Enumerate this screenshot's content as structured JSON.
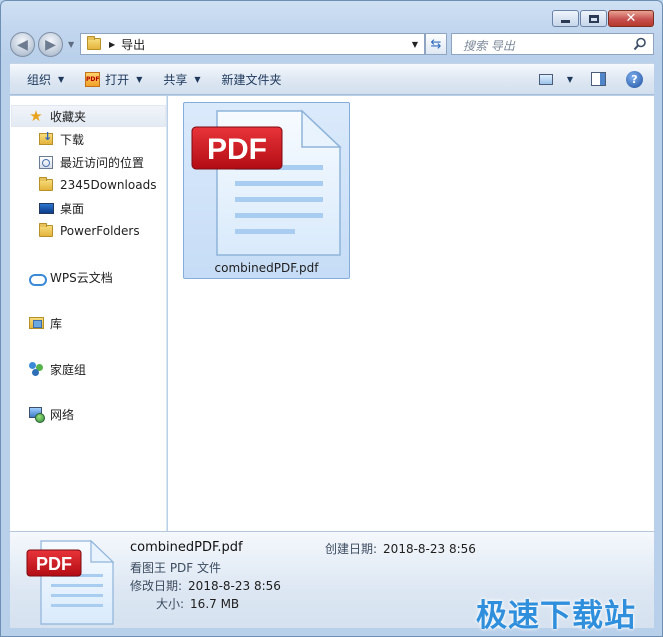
{
  "window": {
    "title": "导出"
  },
  "nav": {
    "breadcrumb": [
      "导出"
    ],
    "search_placeholder": "搜索 导出"
  },
  "toolbar": {
    "organize": "组织",
    "open": "打开",
    "share": "共享",
    "new_folder": "新建文件夹"
  },
  "sidebar": {
    "favorites_label": "收藏夹",
    "favorites": [
      {
        "label": "下载",
        "icon": "download-folder-icon"
      },
      {
        "label": "最近访问的位置",
        "icon": "recent-places-icon"
      },
      {
        "label": "2345Downloads",
        "icon": "folder-icon"
      },
      {
        "label": "桌面",
        "icon": "desktop-icon"
      },
      {
        "label": "PowerFolders",
        "icon": "folder-icon"
      }
    ],
    "groups": [
      {
        "label": "WPS云文档",
        "icon": "cloud-icon"
      },
      {
        "label": "库",
        "icon": "library-icon"
      },
      {
        "label": "家庭组",
        "icon": "homegroup-icon"
      },
      {
        "label": "网络",
        "icon": "network-icon"
      }
    ]
  },
  "files": [
    {
      "name": "combinedPDF.pdf",
      "icon": "pdf-file-icon",
      "icon_text": "PDF",
      "selected": true
    }
  ],
  "details": {
    "name": "combinedPDF.pdf",
    "type": "看图王 PDF 文件",
    "modified_label": "修改日期:",
    "modified_value": "2018-8-23 8:56",
    "size_label": "大小:",
    "size_value": "16.7 MB",
    "created_label": "创建日期:",
    "created_value": "2018-8-23 8:56"
  },
  "watermark": "极速下载站",
  "colors": {
    "accent": "#3399ff",
    "pdf_red": "#c8101a",
    "selection": "#cce2f8"
  }
}
